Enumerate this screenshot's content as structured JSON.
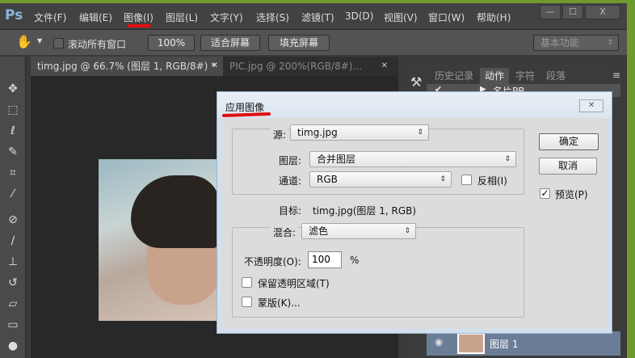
{
  "app": {
    "logo": "Ps",
    "menu": [
      "文件(F)",
      "编辑(E)",
      "图像(I)",
      "图层(L)",
      "文字(Y)",
      "选择(S)",
      "滤镜(T)",
      "3D(D)",
      "视图(V)",
      "窗口(W)",
      "帮助(H)"
    ],
    "window_buttons": [
      "—",
      "☐",
      "X"
    ]
  },
  "options": {
    "scroll_all": "滚动所有窗口",
    "zoom100": "100%",
    "fit_screen": "适合屏幕",
    "fill_screen": "填充屏幕",
    "workspace": "基本功能"
  },
  "tabs": [
    {
      "label": "timg.jpg @ 66.7% (图层 1, RGB/8#) *",
      "active": true
    },
    {
      "label": "PIC.jpg @ 200%(RGB/8#)...",
      "active": false
    }
  ],
  "panel": {
    "tabs": [
      "历史记录",
      "动作",
      "字符",
      "段落"
    ],
    "action_item": "名片PB",
    "layer_name": "图层 1"
  },
  "dialog": {
    "title": "应用图像",
    "source_label": "源:",
    "source_value": "timg.jpg",
    "layer_label": "图层:",
    "layer_value": "合并图层",
    "channel_label": "通道:",
    "channel_value": "RGB",
    "invert_label": "反相(I)",
    "invert_checked": false,
    "target_label": "目标:",
    "target_value": "timg.jpg(图层 1, RGB)",
    "blend_label": "混合:",
    "blend_value": "滤色",
    "opacity_label": "不透明度(O):",
    "opacity_value": "100",
    "opacity_unit": "%",
    "preserve_label": "保留透明区域(T)",
    "preserve_checked": false,
    "mask_label": "蒙版(K)...",
    "mask_checked": false,
    "ok": "确定",
    "cancel": "取消",
    "preview_label": "预览(P)",
    "preview_checked": true,
    "close": "✕"
  },
  "colors": {
    "highlight_underline": "#e01010",
    "layer_selected": "#6b7d96"
  }
}
